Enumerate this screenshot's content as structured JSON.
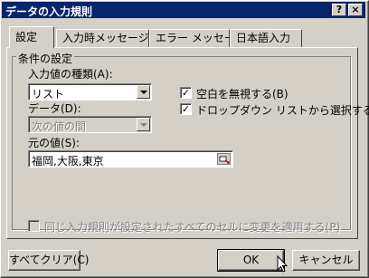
{
  "window": {
    "title": "データの入力規則"
  },
  "titlebar_buttons": {
    "help": "?",
    "close": "×"
  },
  "tabs": [
    {
      "label": "設定"
    },
    {
      "label": "入力時メッセージ"
    },
    {
      "label": "エラー メッセージ"
    },
    {
      "label": "日本語入力"
    }
  ],
  "conditions": {
    "group_label": "条件の設定",
    "allow_label": "入力値の種類(A):",
    "allow_value": "リスト",
    "data_label": "データ(D):",
    "data_value": "次の値の間",
    "source_label": "元の値(S):",
    "source_value": "福岡,大阪,東京",
    "ignore_blank_label": "空白を無視する(B)",
    "ignore_blank_checked": true,
    "dropdown_label": "ドロップダウン リストから選択する(I)",
    "dropdown_checked": true
  },
  "apply_all_label": "同じ入力規則が設定されたすべてのセルに変更を適用する(P)",
  "apply_all_checked": false,
  "buttons": {
    "clear_all": "すべてクリア(C)",
    "ok": "OK",
    "cancel": "キャンセル"
  }
}
